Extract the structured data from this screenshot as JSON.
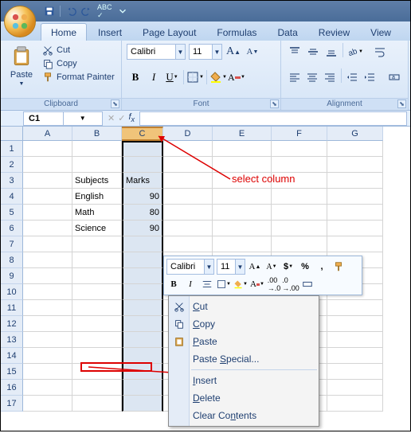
{
  "qat": {
    "tips": [
      "save",
      "undo",
      "redo",
      "abc",
      "down"
    ]
  },
  "tabs": [
    "Home",
    "Insert",
    "Page Layout",
    "Formulas",
    "Data",
    "Review",
    "View"
  ],
  "active_tab": "Home",
  "ribbon": {
    "clipboard": {
      "label": "Clipboard",
      "paste": "Paste",
      "cut": "Cut",
      "copy": "Copy",
      "format_painter": "Format Painter"
    },
    "font": {
      "label": "Font",
      "name": "Calibri",
      "size": "11"
    },
    "alignment": {
      "label": "Alignment"
    }
  },
  "namebox": "C1",
  "columns": [
    "A",
    "B",
    "C",
    "D",
    "E",
    "F",
    "G"
  ],
  "selected_col": "C",
  "rows": 17,
  "cells": {
    "B3": "Subjects",
    "C3": "Marks",
    "B4": "English",
    "C4": "90",
    "B5": "Math",
    "C5": "80",
    "B6": "Science",
    "C6": "90"
  },
  "annotation": {
    "select_column": "select column"
  },
  "mini": {
    "font": "Calibri",
    "size": "11"
  },
  "context_menu": {
    "cut": "Cut",
    "copy": "Copy",
    "paste": "Paste",
    "paste_special": "Paste Special...",
    "insert": "Insert",
    "delete": "Delete",
    "clear": "Clear Contents"
  }
}
